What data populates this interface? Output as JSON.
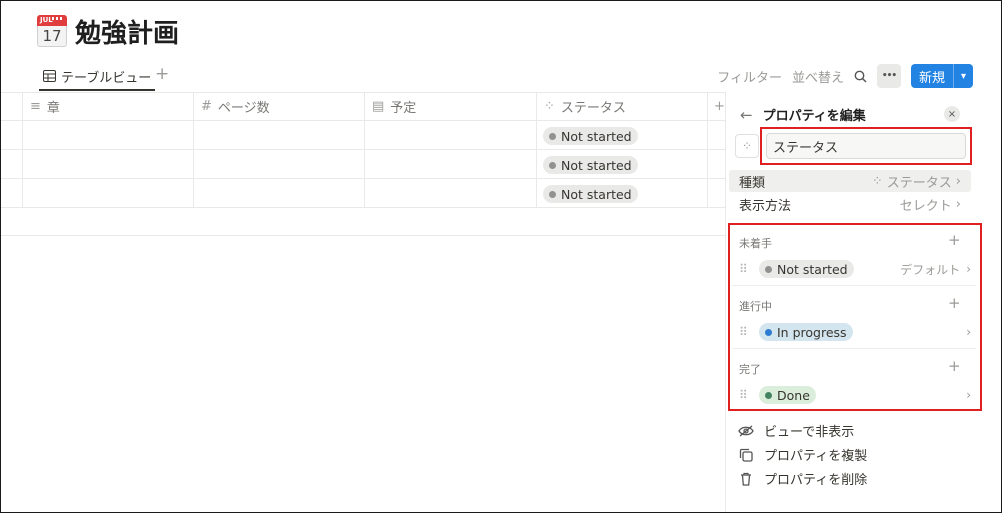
{
  "page": {
    "title": "勉強計画",
    "icon": "calendar-icon",
    "icon_month": "JUL",
    "icon_day": "17"
  },
  "tabs": {
    "active": "テーブルビュー",
    "add": "+"
  },
  "toolbar": {
    "filter": "フィルター",
    "sort": "並べ替え",
    "more": "•••",
    "new_label": "新規",
    "new_chevron": "⌄"
  },
  "table": {
    "columns": [
      {
        "icon": "text-lines-icon",
        "glyph": "≡",
        "label": "章"
      },
      {
        "icon": "hash-icon",
        "glyph": "#",
        "label": "ページ数"
      },
      {
        "icon": "calendar-icon",
        "glyph": "▤",
        "label": "予定"
      },
      {
        "icon": "status-icon",
        "glyph": "⁘",
        "label": "ステータス"
      }
    ],
    "add_column": "+",
    "rows": [
      {
        "status": "Not started"
      },
      {
        "status": "Not started"
      },
      {
        "status": "Not started"
      }
    ]
  },
  "panel": {
    "back": "←",
    "title": "プロパティを編集",
    "close": "×",
    "name_value": "ステータス",
    "type_label": "種類",
    "type_value": "ステータス",
    "display_label": "表示方法",
    "display_value": "セレクト",
    "chevron": "›",
    "groups": [
      {
        "label": "未着手",
        "option": "Not started",
        "right": "デフォルト",
        "dot": "#91918e",
        "bg": "#e9e9e7"
      },
      {
        "label": "進行中",
        "option": "In progress",
        "right": "",
        "dot": "#2e7cd1",
        "bg": "#d3e5ef"
      },
      {
        "label": "完了",
        "option": "Done",
        "right": "",
        "dot": "#448361",
        "bg": "#dbeddb"
      }
    ],
    "actions": {
      "hide": "ビューで非表示",
      "duplicate": "プロパティを複製",
      "delete": "プロパティを削除"
    }
  }
}
